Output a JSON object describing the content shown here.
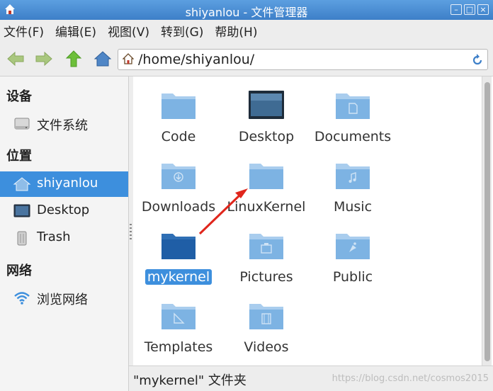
{
  "window": {
    "title": "shiyanlou - 文件管理器",
    "buttons": [
      "minimize-button",
      "maximize-button",
      "close-button"
    ]
  },
  "menubar": {
    "items": [
      "文件(F)",
      "编辑(E)",
      "视图(V)",
      "转到(G)",
      "帮助(H)"
    ]
  },
  "toolbar": {
    "back_icon": "arrow-left-icon",
    "forward_icon": "arrow-right-icon",
    "up_icon": "arrow-up-icon",
    "home_icon": "home-icon"
  },
  "location": {
    "path": "/home/shiyanlou/"
  },
  "sidebar": {
    "sections": [
      {
        "heading": "设备",
        "items": [
          {
            "label": "文件系统",
            "icon": "drive-icon"
          }
        ]
      },
      {
        "heading": "位置",
        "items": [
          {
            "label": "shiyanlou",
            "icon": "home-icon",
            "active": true
          },
          {
            "label": "Desktop",
            "icon": "desktop-icon"
          },
          {
            "label": "Trash",
            "icon": "trash-icon"
          }
        ]
      },
      {
        "heading": "网络",
        "items": [
          {
            "label": "浏览网络",
            "icon": "wifi-icon"
          }
        ]
      }
    ]
  },
  "files": [
    {
      "name": "Code",
      "icon": "folder-icon"
    },
    {
      "name": "Desktop",
      "icon": "desktop-folder-icon"
    },
    {
      "name": "Documents",
      "icon": "documents-folder-icon"
    },
    {
      "name": "Downloads",
      "icon": "downloads-folder-icon"
    },
    {
      "name": "LinuxKernel",
      "icon": "folder-icon"
    },
    {
      "name": "Music",
      "icon": "music-folder-icon"
    },
    {
      "name": "mykernel",
      "icon": "folder-icon",
      "selected": true
    },
    {
      "name": "Pictures",
      "icon": "pictures-folder-icon"
    },
    {
      "name": "Public",
      "icon": "public-folder-icon"
    },
    {
      "name": "Templates",
      "icon": "templates-folder-icon"
    },
    {
      "name": "Videos",
      "icon": "videos-folder-icon"
    }
  ],
  "status": {
    "text": "\"mykernel\" 文件夹",
    "watermark": "https://blog.csdn.net/cosmos2015"
  },
  "colors": {
    "titlebar": "#4a8fd6",
    "selection": "#3d8fdd",
    "folder": "#6ea8dd",
    "annotation_arrow": "#e0261c"
  }
}
